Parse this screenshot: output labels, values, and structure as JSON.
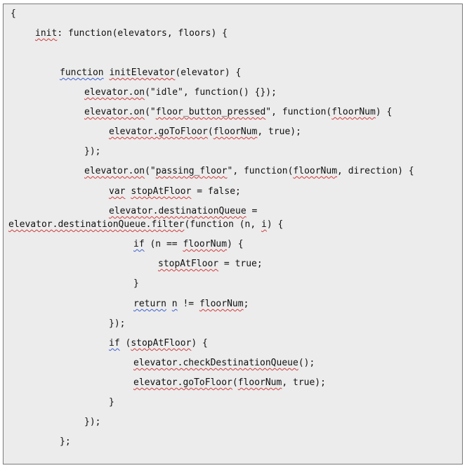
{
  "document": {
    "lines": [
      {
        "indent": 0,
        "segments": [
          {
            "t": "{"
          }
        ]
      },
      {
        "indent": 1,
        "segments": [
          {
            "t": "init",
            "spell": true
          },
          {
            "t": ": function(elevators, floors) {"
          }
        ]
      },
      {
        "indent": 0,
        "segments": []
      },
      {
        "indent": 2,
        "segments": [
          {
            "t": "function",
            "grammar": true
          },
          {
            "t": " "
          },
          {
            "t": "initElevator",
            "spell": true
          },
          {
            "t": "(elevator) {"
          }
        ]
      },
      {
        "indent": 3,
        "segments": [
          {
            "t": "elevator.on",
            "spell": true
          },
          {
            "t": "(\"idle\", function() {});"
          }
        ]
      },
      {
        "indent": 3,
        "segments": [
          {
            "t": "elevator.on",
            "spell": true
          },
          {
            "t": "(\""
          },
          {
            "t": "floor_button_pressed",
            "spell": true
          },
          {
            "t": "\", function("
          },
          {
            "t": "floorNum",
            "spell": true
          },
          {
            "t": ") {"
          }
        ]
      },
      {
        "indent": 4,
        "segments": [
          {
            "t": "elevator.goToFloor",
            "spell": true
          },
          {
            "t": "("
          },
          {
            "t": "floorNum",
            "spell": true
          },
          {
            "t": ", true);"
          }
        ]
      },
      {
        "indent": 3,
        "segments": [
          {
            "t": "});"
          }
        ]
      },
      {
        "indent": 3,
        "segments": [
          {
            "t": "elevator.on",
            "spell": true
          },
          {
            "t": "(\""
          },
          {
            "t": "passing_floor",
            "spell": true
          },
          {
            "t": "\", function("
          },
          {
            "t": "floorNum",
            "spell": true
          },
          {
            "t": ", direction) {"
          }
        ]
      },
      {
        "indent": 4,
        "segments": [
          {
            "t": "var",
            "spell": true
          },
          {
            "t": " "
          },
          {
            "t": "stopAtFloor",
            "spell": true
          },
          {
            "t": " = false;"
          }
        ]
      },
      {
        "indent": 4,
        "segments": [
          {
            "t": "elevator.destinationQueue",
            "spell": true
          },
          {
            "t": " ="
          }
        ]
      },
      {
        "indent": 0,
        "segments": [
          {
            "t": "elevator.destinationQueue.filter",
            "spell": true
          },
          {
            "t": "(function (n, "
          },
          {
            "t": "i",
            "spell": true
          },
          {
            "t": ") {"
          }
        ]
      },
      {
        "indent": 5,
        "segments": [
          {
            "t": "if",
            "grammar": true
          },
          {
            "t": " (n == "
          },
          {
            "t": "floorNum",
            "spell": true
          },
          {
            "t": ") {"
          }
        ]
      },
      {
        "indent": 6,
        "segments": [
          {
            "t": "stopAtFloor",
            "spell": true
          },
          {
            "t": " = true;"
          }
        ]
      },
      {
        "indent": 5,
        "segments": [
          {
            "t": "}"
          }
        ]
      },
      {
        "indent": 5,
        "segments": [
          {
            "t": "return",
            "grammar": true
          },
          {
            "t": " "
          },
          {
            "t": "n",
            "grammar": true
          },
          {
            "t": " != "
          },
          {
            "t": "floorNum",
            "spell": true
          },
          {
            "t": ";"
          }
        ]
      },
      {
        "indent": 4,
        "segments": [
          {
            "t": "});"
          }
        ]
      },
      {
        "indent": 4,
        "segments": [
          {
            "t": "if",
            "grammar": true
          },
          {
            "t": " ("
          },
          {
            "t": "stopAtFloor",
            "spell": true
          },
          {
            "t": ") {"
          }
        ]
      },
      {
        "indent": 5,
        "segments": [
          {
            "t": "elevator.checkDestinationQueue",
            "spell": true
          },
          {
            "t": "();"
          }
        ]
      },
      {
        "indent": 5,
        "segments": [
          {
            "t": "elevator.goToFloor",
            "spell": true
          },
          {
            "t": "("
          },
          {
            "t": "floorNum",
            "spell": true
          },
          {
            "t": ", true);"
          }
        ]
      },
      {
        "indent": 4,
        "segments": [
          {
            "t": "}"
          }
        ]
      },
      {
        "indent": 3,
        "segments": [
          {
            "t": "});"
          }
        ]
      },
      {
        "indent": 2,
        "segments": [
          {
            "t": "};"
          }
        ]
      }
    ]
  }
}
